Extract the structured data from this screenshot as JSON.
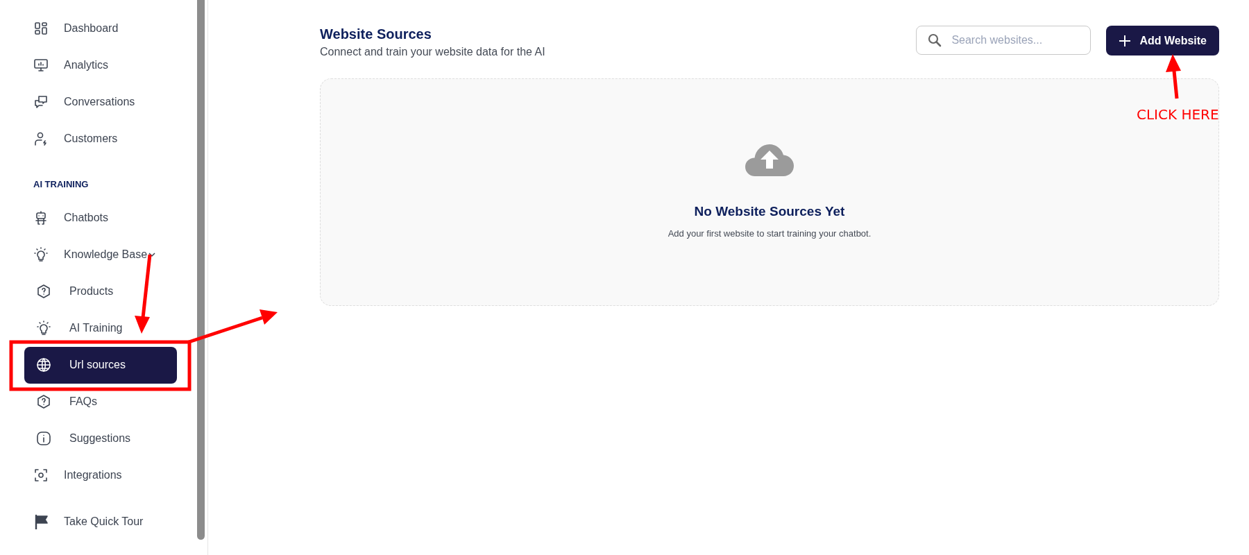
{
  "sidebar": {
    "items": [
      {
        "kind": "link",
        "label": "Dashboard",
        "selected": false
      },
      {
        "kind": "link",
        "label": "Analytics",
        "selected": false
      },
      {
        "kind": "link",
        "label": "Conversations",
        "selected": false
      },
      {
        "kind": "link",
        "label": "Customers",
        "selected": false
      },
      {
        "kind": "heading",
        "label": "AI TRAINING"
      },
      {
        "kind": "link",
        "label": "Chatbots",
        "selected": false
      },
      {
        "kind": "group",
        "label": "Knowledge Base",
        "selected": false
      },
      {
        "kind": "sublink",
        "label": "Products",
        "selected": false
      },
      {
        "kind": "sublink",
        "label": "AI Training",
        "selected": false
      },
      {
        "kind": "sublink",
        "label": "Url sources",
        "selected": true
      },
      {
        "kind": "sublink",
        "label": "FAQs",
        "selected": false
      },
      {
        "kind": "sublink",
        "label": "Suggestions",
        "selected": false
      },
      {
        "kind": "link",
        "label": "Integrations",
        "selected": false
      },
      {
        "kind": "tour",
        "label": "Take Quick Tour",
        "selected": false
      }
    ]
  },
  "header": {
    "title": "Website Sources",
    "subtitle": "Connect and train your website data for the AI"
  },
  "search": {
    "placeholder": "Search websites..."
  },
  "add_button": {
    "label": "Add Website"
  },
  "empty_state": {
    "title": "No Website Sources Yet",
    "text": "Add your first website to start training your chatbot."
  },
  "annotation": {
    "text": "CLICK HERE"
  }
}
